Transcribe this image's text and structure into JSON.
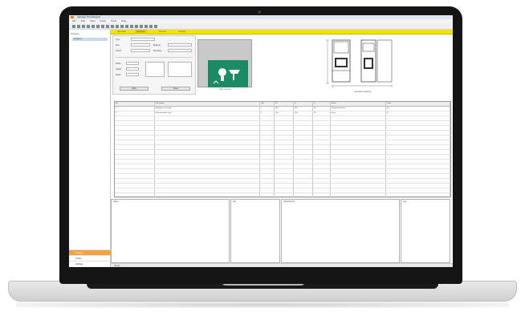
{
  "app": {
    "title": "Signage Pro Designer",
    "menus": [
      "File",
      "Edit",
      "View",
      "Insert",
      "Tools",
      "Help"
    ],
    "toolbar_buttons": 18
  },
  "left_panel": {
    "header": "Projects",
    "selected_item": "Project 1",
    "nav_items": [
      {
        "label": "Designer",
        "active": true
      },
      {
        "label": "Library",
        "active": false
      },
      {
        "label": "Settings",
        "active": false
      }
    ]
  },
  "tabs": [
    "Sign data",
    "Attributes",
    "Preview",
    "Drawing"
  ],
  "form": {
    "labels": [
      "Type",
      "Size",
      "Material",
      "Colour",
      "Mounting",
      "Width",
      "Height",
      "Depth"
    ],
    "buttons": [
      "Apply",
      "Reset"
    ]
  },
  "preview": {
    "caption": "Sign preview",
    "sign_color": "#1a8b62"
  },
  "drawing": {
    "caption": "Elevation drawing"
  },
  "grid": {
    "columns": [
      "No.",
      "Description",
      "Qty",
      "W",
      "H",
      "D",
      "Finish",
      "Note"
    ],
    "rows": [
      [
        "1",
        "Emergency exit sign",
        "1",
        "200",
        "300",
        "20",
        "Photoluminescent",
        "A"
      ],
      [
        "2",
        "First aid station sign",
        "1",
        "200",
        "200",
        "20",
        "Vinyl",
        "B"
      ]
    ],
    "empty_rows": 17
  },
  "bottom_panes": [
    "Notes",
    "Info",
    "Attachments",
    "Log"
  ],
  "status": {
    "text": "Ready"
  },
  "colors": {
    "accent": "#f3e400",
    "nav_active": "#f2a23a",
    "sign": "#1a8b62"
  }
}
